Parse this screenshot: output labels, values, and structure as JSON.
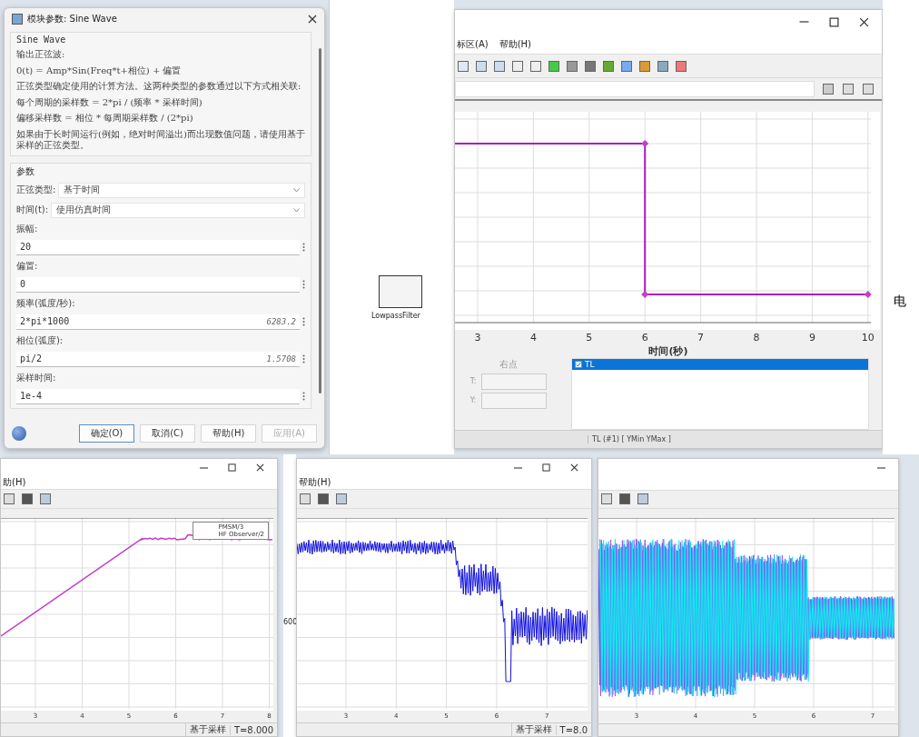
{
  "param_dialog": {
    "title": "模块参数: Sine Wave",
    "block_name": "Sine Wave",
    "paragraphs": [
      "输出正弦波:",
      "0(t) = Amp*Sin(Freq*t+相位) + 偏置",
      "正弦类型确定使用的计算方法。这两种类型的参数通过以下方式相关联:",
      "每个周期的采样数 = 2*pi / (频率 * 采样时间)",
      "偏移采样数 = 相位 * 每周期采样数 / (2*pi)",
      "如果由于长时间运行(例如，绝对时间溢出)而出现数值问题，请使用基于采样的正弦类型。"
    ],
    "params_heading": "参数",
    "dropdowns": [
      {
        "label": "正弦类型:",
        "value": "基于时间"
      },
      {
        "label": "时间(t):",
        "value": "使用仿真时间"
      }
    ],
    "fields": [
      {
        "label": "振幅:",
        "value": "20"
      },
      {
        "label": "偏置:",
        "value": "0"
      },
      {
        "label": "频率(弧度/秒):",
        "value": "2*pi*1000",
        "evaluated": "6283.2"
      },
      {
        "label": "相位(弧度):",
        "value": "pi/2",
        "evaluated": "1.5708"
      },
      {
        "label": "采样时间:",
        "value": "1e-4"
      }
    ],
    "buttons": [
      {
        "label": "确定(O)",
        "disabled": false,
        "focused": true
      },
      {
        "label": "取消(C)",
        "disabled": false,
        "focused": false
      },
      {
        "label": "帮助(H)",
        "disabled": false,
        "focused": false
      },
      {
        "label": "应用(A)",
        "disabled": true,
        "focused": false
      }
    ]
  },
  "model_canvas": {
    "block_label": "LowpassFilter",
    "side_char": "电",
    "side_number": "600"
  },
  "scope_main": {
    "menu": [
      "标区(A)",
      "帮助(H)"
    ],
    "xticks": [
      "3",
      "4",
      "5",
      "6",
      "7",
      "8",
      "9",
      "10"
    ],
    "xlabel": "时间(秒)",
    "cursor_heading": "右点",
    "cursor_fields": [
      "T:",
      "Y:"
    ],
    "signals": [
      {
        "label": "TL",
        "selected": true
      }
    ],
    "status": "TL (#1)  [ YMin YMax ]"
  },
  "scopes": [
    {
      "kind": "ramp",
      "menu": [
        "助(H)"
      ],
      "legend": [
        "PMSM/3",
        "HF Observer/2"
      ],
      "xticks": [
        "3",
        "4",
        "5",
        "6",
        "7",
        "8"
      ],
      "status": [
        "基于采样",
        "T=8.000"
      ]
    },
    {
      "kind": "noisy",
      "menu": [
        "帮助(H)"
      ],
      "xticks": [
        "3",
        "4",
        "5",
        "6",
        "7"
      ],
      "status": [
        "基于采样",
        "T=8.0"
      ]
    },
    {
      "kind": "multi",
      "xticks": [
        "3",
        "4",
        "5",
        "6",
        "7"
      ]
    }
  ]
}
